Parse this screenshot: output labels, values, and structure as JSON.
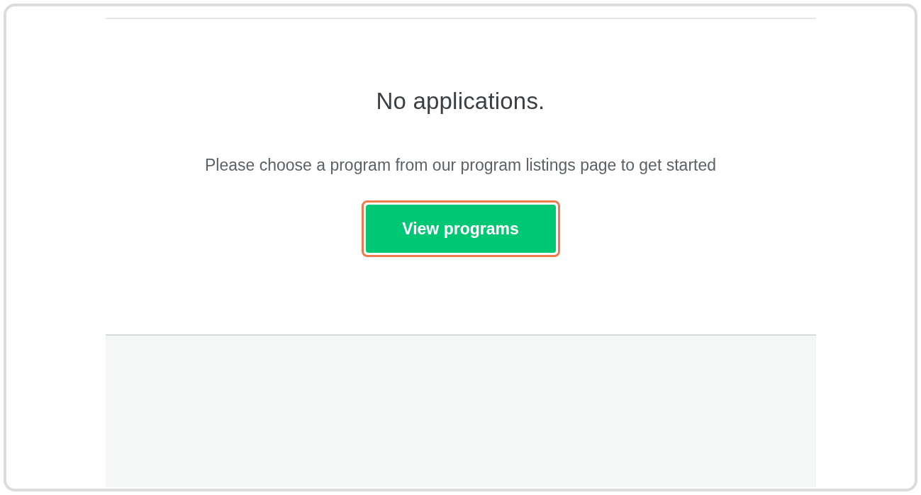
{
  "empty_state": {
    "title": "No applications.",
    "message": "Please choose a program from our program listings page to get started",
    "button": {
      "label": "View programs",
      "highlighted": true
    }
  }
}
